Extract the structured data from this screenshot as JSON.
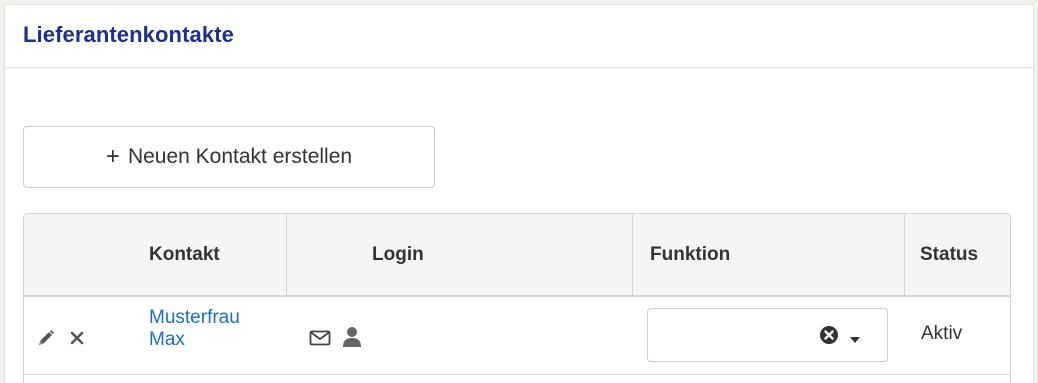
{
  "panel": {
    "title": "Lieferantenkontakte"
  },
  "toolbar": {
    "new_contact_plus": "+",
    "new_contact_label": "Neuen Kontakt erstellen"
  },
  "table": {
    "headers": {
      "contact": "Kontakt",
      "login": "Login",
      "function": "Funktion",
      "status": "Status"
    },
    "rows": [
      {
        "contact_line1": "Musterfrau",
        "contact_line2": "Max",
        "function_value": "",
        "status": "Aktiv",
        "icons": [
          "edit-icon",
          "delete-icon",
          "envelope-icon",
          "user-icon",
          "clear-icon",
          "caret-down-icon"
        ]
      }
    ]
  },
  "colors": {
    "title": "#1d2f8f",
    "link": "#1f6fb5",
    "header_bg": "#f5f5f5",
    "border": "#d5d5d5"
  }
}
